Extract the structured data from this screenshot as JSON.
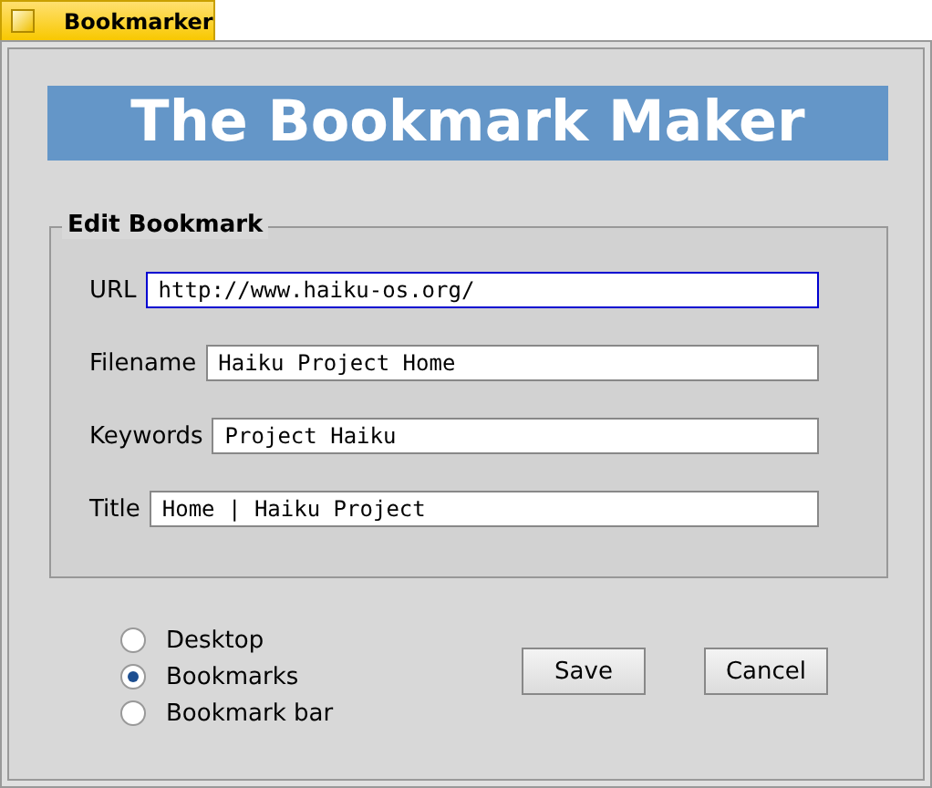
{
  "window": {
    "title": "Bookmarker"
  },
  "banner": "The Bookmark Maker",
  "group": {
    "title": "Edit Bookmark",
    "fields": [
      {
        "label": "URL",
        "value": "http://www.haiku-os.org/",
        "focused": true
      },
      {
        "label": "Filename",
        "value": "Haiku Project Home",
        "focused": false
      },
      {
        "label": "Keywords",
        "value": "Project Haiku",
        "focused": false
      },
      {
        "label": "Title",
        "value": "Home | Haiku Project",
        "focused": false
      }
    ]
  },
  "destinations": [
    {
      "label": "Desktop",
      "selected": false
    },
    {
      "label": "Bookmarks",
      "selected": true
    },
    {
      "label": "Bookmark bar",
      "selected": false
    }
  ],
  "buttons": [
    "Save",
    "Cancel"
  ]
}
